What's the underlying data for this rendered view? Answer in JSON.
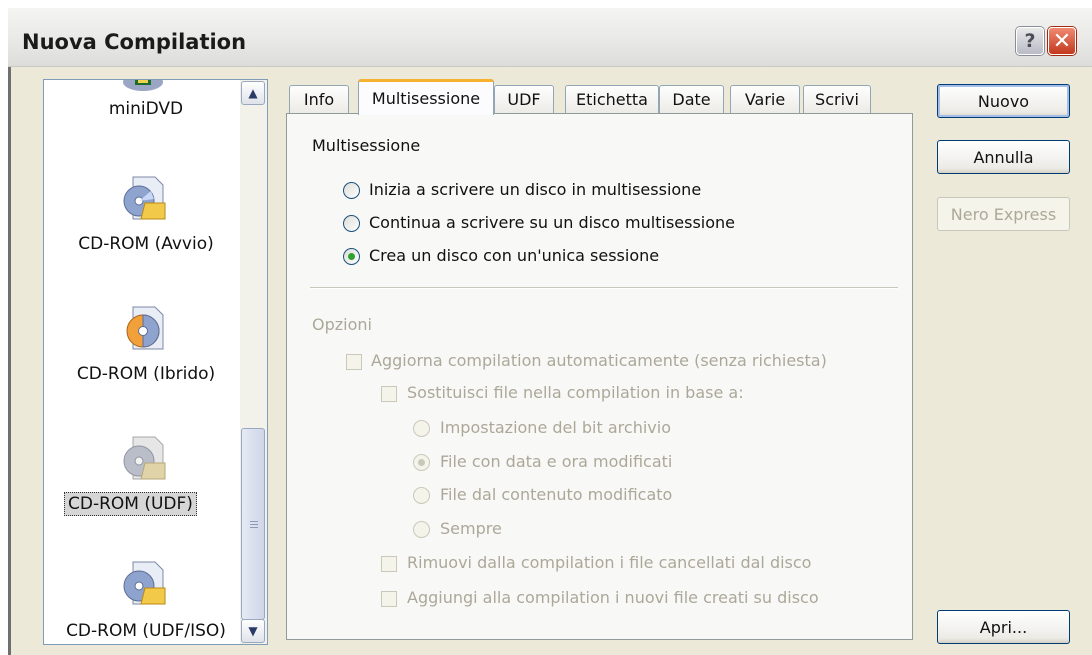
{
  "window": {
    "title": "Nuova Compilation"
  },
  "titlebar": {
    "help_glyph": "?",
    "close_glyph": "✕"
  },
  "list": {
    "items": [
      {
        "label": "miniDVD",
        "icon": "dvd-icon"
      },
      {
        "label": "CD-ROM (Avvio)",
        "icon": "cd-folder-icon"
      },
      {
        "label": "CD-ROM (Ibrido)",
        "icon": "cd-hybrid-icon"
      },
      {
        "label": "CD-ROM (UDF)",
        "icon": "cd-folder-icon",
        "selected": true
      },
      {
        "label": "CD-ROM (UDF/ISO)",
        "icon": "cd-folder-icon"
      }
    ],
    "scroll_up": "▲",
    "scroll_down": "▼"
  },
  "tabs": [
    {
      "label": "Info"
    },
    {
      "label": "Multisessione",
      "active": true
    },
    {
      "label": "UDF"
    },
    {
      "label": "Etichetta"
    },
    {
      "label": "Date"
    },
    {
      "label": "Varie"
    },
    {
      "label": "Scrivi"
    }
  ],
  "multisession": {
    "heading": "Multisessione",
    "options": [
      {
        "label": "Inizia a scrivere un disco in multisessione",
        "selected": false
      },
      {
        "label": "Continua a scrivere su un disco multisessione",
        "selected": false
      },
      {
        "label": "Crea un disco con un'unica sessione",
        "selected": true
      }
    ]
  },
  "options": {
    "heading": "Opzioni",
    "auto_update": "Aggiorna compilation automaticamente (senza richiesta)",
    "replace_files": "Sostituisci file nella compilation in base a:",
    "replace_modes": [
      {
        "label": "Impostazione del bit archivio",
        "selected": false
      },
      {
        "label": "File con data e ora modificati",
        "selected": true
      },
      {
        "label": "File dal contenuto modificato",
        "selected": false
      },
      {
        "label": "Sempre",
        "selected": false
      }
    ],
    "remove_deleted": "Rimuovi dalla compilation i file cancellati dal disco",
    "add_new": "Aggiungi alla compilation i nuovi file creati su disco"
  },
  "buttons": {
    "new": "Nuovo",
    "cancel": "Annulla",
    "nero_express": "Nero Express",
    "open": "Apri..."
  },
  "colors": {
    "tab_accent": "#f6b12e",
    "radio_dot": "#2fa12f",
    "disabled_text": "#aca899"
  }
}
